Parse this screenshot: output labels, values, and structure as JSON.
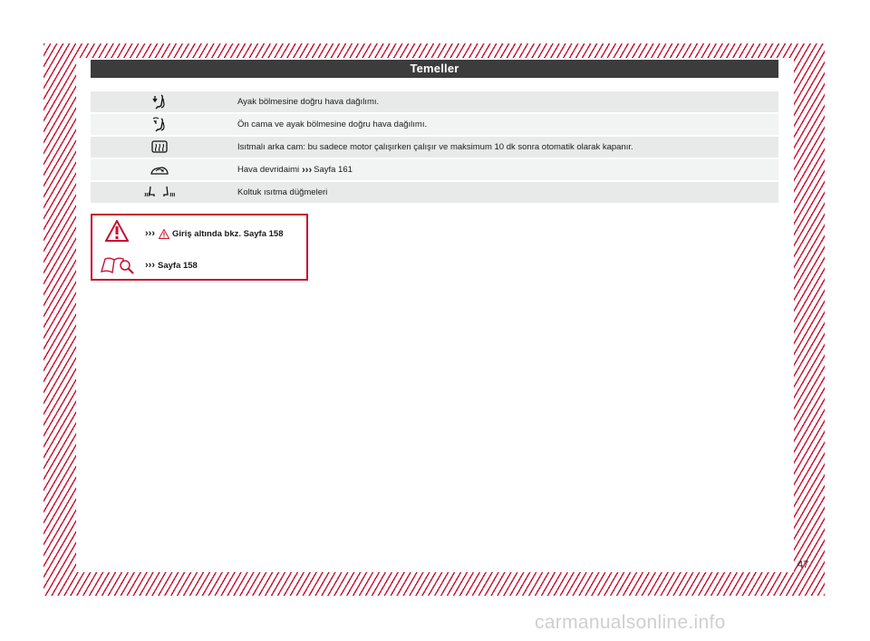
{
  "header": {
    "title": "Temeller"
  },
  "rows": [
    {
      "icon": "footwell-airflow-icon",
      "text": "Ayak bölmesine doğru hava dağılımı."
    },
    {
      "icon": "windshield-footwell-airflow-icon",
      "text": "Ön cama ve ayak bölmesine doğru hava dağılımı."
    },
    {
      "icon": "rear-window-heating-icon",
      "text": "Isıtmalı arka cam: bu sadece motor çalışırken çalışır ve maksimum 10 dk sonra otomatik olarak kapanır."
    },
    {
      "icon": "air-recirculation-icon",
      "text": "Hava devridaimi",
      "arrows": "›››",
      "ref": "Sayfa 161"
    },
    {
      "icon": "seat-heating-icon",
      "text": "Koltuk ısıtma düğmeleri"
    }
  ],
  "info_box": {
    "warning_ref": {
      "arrows": "›››",
      "text": "Giriş altında bkz. Sayfa 158"
    },
    "book_ref": {
      "arrows": "›››",
      "text": "Sayfa 158"
    }
  },
  "page_number": "47",
  "watermark": "carmanualsonline.info",
  "colors": {
    "accent": "#c8102e",
    "header_bg": "#3c3c3c",
    "row_bg": "#e8eaea"
  }
}
